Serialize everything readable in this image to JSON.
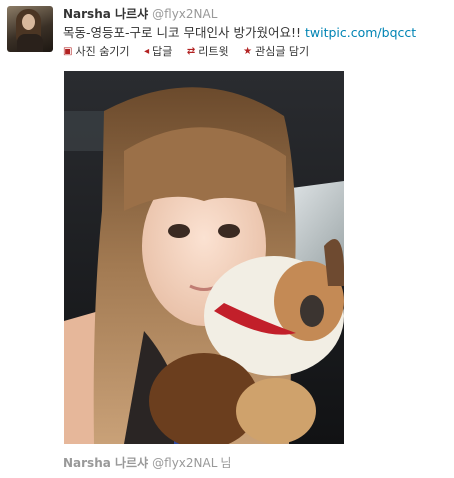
{
  "tweet": {
    "name": "Narsha 나르샤",
    "handle": "@flyx2NAL",
    "text": "목동-영등포-구로 니코 무대인사 방가웠어요!!",
    "link": "twitpic.com/bqcct",
    "actions": [
      {
        "icon": "photo-icon",
        "label": "사진 숨기기"
      },
      {
        "icon": "reply-arrow-icon",
        "label": "답글"
      },
      {
        "icon": "retweet-icon",
        "label": "리트윗"
      },
      {
        "icon": "star-icon",
        "label": "관심글 담기"
      }
    ]
  },
  "footer": {
    "name": "Narsha 나르샤",
    "handle": "@flyx2NAL",
    "suffix": "님"
  },
  "colors": {
    "link": "#0084b4",
    "action_icon": "#b22222",
    "muted": "#999999"
  }
}
